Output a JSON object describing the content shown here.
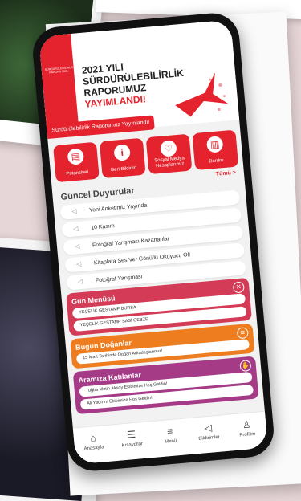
{
  "banner": {
    "side_text": "SÜRDÜRÜLEBİLİRLİK RAPORU 2021",
    "title_line1": "2021 YILI",
    "title_line2": "SÜRDÜRÜLEBİLİRLİK",
    "title_line3": "RAPORUMUZ",
    "title_highlight": "YAYIMLANDI!",
    "ribbon": "Sürdürülebilirlik Raporumuz Yayınlandı!"
  },
  "quick_actions": [
    {
      "label": "Potansiyel",
      "icon": "book-icon"
    },
    {
      "label": "Geri Bildirim",
      "icon": "info-icon"
    },
    {
      "label": "Sosyal Medya Hesaplarımız",
      "icon": "heart-icon"
    },
    {
      "label": "Bordro",
      "icon": "document-icon"
    }
  ],
  "all_link": "Tümü >",
  "announcements": {
    "title": "Güncel Duyurular",
    "items": [
      "Yeni Anketimiz Yayında",
      "10 Kasım",
      "Fotoğraf Yarışması Kazananlar",
      "Kitaplara Ses Ver Gönüllü Okuyucu Ol!",
      "Fotoğraf Yarışması"
    ]
  },
  "menu_card": {
    "title": "Gün Menüsü",
    "rows": [
      "YEÇELİK GESTAMP BURSA",
      "YEÇELİK GESTAMP ŞASİ GEBZE"
    ]
  },
  "birthday_card": {
    "title": "Bugün Doğanlar",
    "rows": [
      "15 Mart Tarihinde Doğan Arkadaşlarımız!"
    ]
  },
  "join_card": {
    "title": "Aramıza Katılanlar",
    "rows": [
      "Tuğba Metin Aksoy Ekibimize Hoş Geldin!",
      "Ali Yıldırım Ekibimize Hoş Geldin!"
    ]
  },
  "tabs": [
    {
      "label": "Anasayfa",
      "icon": "home-icon"
    },
    {
      "label": "Kısayollar",
      "icon": "shortcuts-icon"
    },
    {
      "label": "Menü",
      "icon": "menu-icon"
    },
    {
      "label": "Bildirimler",
      "icon": "megaphone-icon"
    },
    {
      "label": "Profilim",
      "icon": "profile-icon"
    }
  ],
  "colors": {
    "brand_red": "#e4232e",
    "menu_card": "#d43b56",
    "birthday_card": "#ee7d1f",
    "join_card": "#a53a86"
  }
}
